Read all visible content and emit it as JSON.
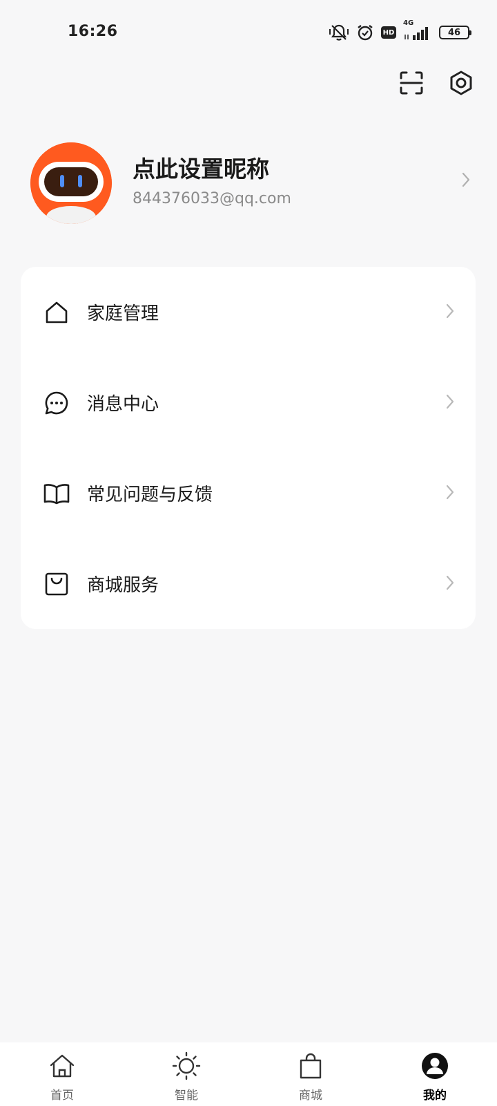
{
  "status_bar": {
    "time": "16:26",
    "network": "4G",
    "hd": "HD",
    "battery": "46",
    "icons": [
      "mute-vibrate-icon",
      "alarm-icon",
      "hd-icon",
      "signal-icon",
      "battery-icon"
    ]
  },
  "header": {
    "actions": [
      "scan-icon",
      "settings-icon"
    ]
  },
  "profile": {
    "nickname": "点此设置昵称",
    "email": "844376033@qq.com",
    "avatar_color": "#ff5a1f"
  },
  "menu": {
    "items": [
      {
        "label": "家庭管理",
        "icon": "home-icon"
      },
      {
        "label": "消息中心",
        "icon": "message-icon"
      },
      {
        "label": "常见问题与反馈",
        "icon": "book-icon"
      },
      {
        "label": "商城服务",
        "icon": "shopping-bag-icon"
      }
    ]
  },
  "bottom_nav": {
    "items": [
      {
        "label": "首页",
        "icon": "home-icon",
        "active": false
      },
      {
        "label": "智能",
        "icon": "sun-icon",
        "active": false
      },
      {
        "label": "商城",
        "icon": "bag-icon",
        "active": false
      },
      {
        "label": "我的",
        "icon": "user-icon",
        "active": true
      }
    ]
  },
  "colors": {
    "background": "#f7f7f8",
    "card": "#ffffff",
    "accent": "#ff5a1f",
    "text_primary": "#1a1a1a",
    "text_secondary": "#8a8a8a"
  }
}
